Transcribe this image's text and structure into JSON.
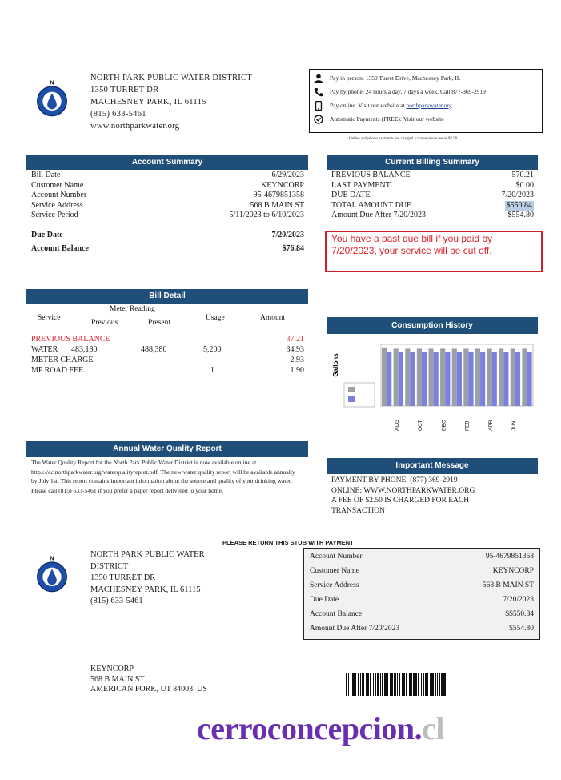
{
  "district": {
    "name": "NORTH PARK PUBLIC WATER DISTRICT",
    "street": "1350 TURRET DR",
    "city": "MACHESNEY PARK, IL 61115",
    "phone": "(815) 633-5461",
    "web": "www.northparkwater.org"
  },
  "payment_options": {
    "in_person": "Pay in person: 1350 Turret Drive, Machesney Park, IL",
    "by_phone": "Pay by phone: 24 hours a day, 7 days a week. Call 877-369-2919",
    "online_prefix": "Pay online. Visit our website at",
    "online_link": "northparkwater.org",
    "automatic": "Automatic Payments (FREE): Visit our website",
    "note": "Online and phone payments are charged a convenience fee of $2.50"
  },
  "account_summary": {
    "title": "Account Summary",
    "rows": [
      {
        "label": "Bill Date",
        "value": "6/29/2023"
      },
      {
        "label": "Customer Name",
        "value": "KEYNCORP"
      },
      {
        "label": "Account Number",
        "value": "95-4679851358"
      },
      {
        "label": "Service Address",
        "value": "568 B MAIN ST"
      },
      {
        "label": "Service Period",
        "value": "5/11/2023 to 6/10/2023"
      }
    ],
    "due_date_label": "Due Date",
    "due_date": "7/20/2023",
    "balance_label": "Account Balance",
    "balance": "$76.84"
  },
  "billing_summary": {
    "title": "Current Billing Summary",
    "rows": [
      {
        "label": "PREVIOUS BALANCE",
        "value": "570.21"
      },
      {
        "label": "LAST PAYMENT",
        "value": "$0.00"
      },
      {
        "label": "DUE DATE",
        "value": "7/20/2023"
      },
      {
        "label": "TOTAL AMOUNT DUE",
        "value": "$550.84"
      },
      {
        "label": "Amount Due After 7/20/2023",
        "value": "$554.80"
      }
    ],
    "warning": "You have a past due bill if you paid by 7/20/2023, your service will be cut off."
  },
  "bill_detail": {
    "title": "Bill Detail",
    "headers": {
      "service": "Service",
      "meter_reading": "Meter Reading",
      "previous": "Previous",
      "present": "Present",
      "usage": "Usage",
      "amount": "Amount"
    },
    "rows": [
      {
        "service": "PREVIOUS BALANCE",
        "previous": "",
        "present": "",
        "usage": "",
        "amount": "37.21",
        "red": true
      },
      {
        "service": "WATER",
        "previous": "483,180",
        "present": "488,380",
        "usage": "5,200",
        "amount": "34.93"
      },
      {
        "service": "METER CHARGE",
        "previous": "",
        "present": "",
        "usage": "",
        "amount": "2.93"
      },
      {
        "service": "MP ROAD FEE",
        "previous": "",
        "present": "",
        "usage": "1",
        "amount": "1.90"
      }
    ]
  },
  "consumption": {
    "title": "Consumption History",
    "ylabel": "Gallons"
  },
  "chart_data": {
    "type": "bar",
    "title": "Consumption History",
    "ylabel": "Gallons",
    "tick_labels": [
      "AUG",
      "OCT",
      "DEC",
      "FEB",
      "APR",
      "JUN"
    ],
    "series": [
      {
        "color": "#9aa0a8",
        "values": [
          0.95,
          0.93,
          0.93,
          0.93,
          0.93,
          0.93,
          0.93,
          0.93,
          0.93,
          0.93,
          0.93,
          0.93,
          0.93
        ]
      },
      {
        "color": "#7b7fe0",
        "values": [
          0.88,
          0.88,
          0.88,
          0.88,
          0.88,
          0.88,
          0.88,
          0.88,
          0.88,
          0.88,
          0.88,
          0.88,
          0.88
        ]
      }
    ]
  },
  "water_quality": {
    "title": "Annual Water Quality Report",
    "text": "The Water Quality Report for the North Park Public Water District is now available online at https://cc.northparkwater.org/waterqualityreport.pdf. The new water quality report will be available annually by July 1st. This report contains important information about the source and quality of your drinking water. Please call (815) 633-5461 if you prefer a paper report delivered to your home."
  },
  "important_message": {
    "title": "Important Message",
    "lines": [
      "PAYMENT BY PHONE: (877) 369-2919",
      "ONLINE: WWW.NORTHPARKWATER.ORG",
      "A FEE OF $2.50 IS CHARGED FOR EACH",
      "TRANSACTION"
    ]
  },
  "stub": {
    "return_note": "PLEASE RETURN THIS STUB WITH PAYMENT",
    "district_lines": [
      "NORTH PARK PUBLIC WATER",
      "DISTRICT",
      "1350 TURRET DR",
      "MACHESNEY PARK, IL 61115",
      "(815) 633-5461"
    ],
    "rows": [
      {
        "label": "Account Number",
        "value": "95-4679851358"
      },
      {
        "label": "Customer Name",
        "value": "KEYNCORP"
      },
      {
        "label": "Service Address",
        "value": "568 B MAIN ST"
      },
      {
        "label": "Due Date",
        "value": "7/20/2023"
      },
      {
        "label": "Account Balance",
        "value": "$$550.84"
      },
      {
        "label": "Amount Due After 7/20/2023",
        "value": "$554.80"
      }
    ]
  },
  "customer": {
    "lines": [
      "KEYNCORP",
      "568 B MAIN ST",
      "AMERICAN FORK, UT 84003, US"
    ]
  },
  "watermark": {
    "main": "cerroconcepcion.",
    "tld": "cl"
  }
}
